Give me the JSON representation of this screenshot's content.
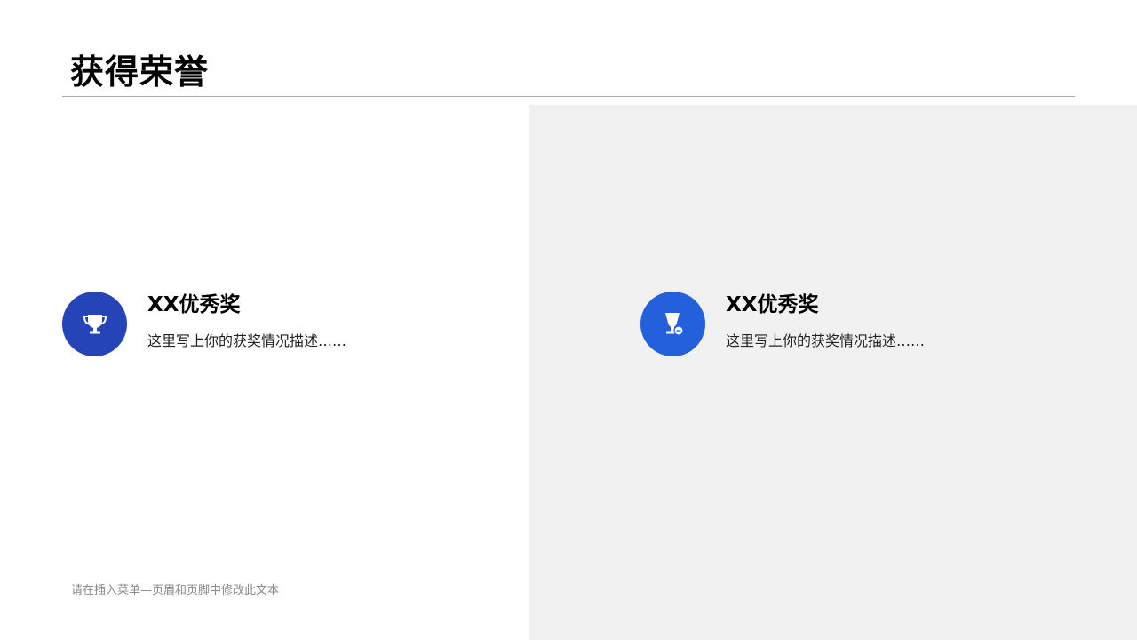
{
  "slide": {
    "title": "获得荣誉",
    "colors": {
      "accent_dark_blue": "#2444b8",
      "accent_blue": "#2460db",
      "panel_gray": "#f1f1f2"
    }
  },
  "awards": [
    {
      "icon": "trophy-icon",
      "heading": "XX优秀奖",
      "description": "这里写上你的获奖情况描述……"
    },
    {
      "icon": "trophy-ribbon-icon",
      "heading": "XX优秀奖",
      "description": "这里写上你的获奖情况描述……"
    }
  ],
  "footer": {
    "text": "请在插入菜单—页眉和页脚中修改此文本"
  }
}
